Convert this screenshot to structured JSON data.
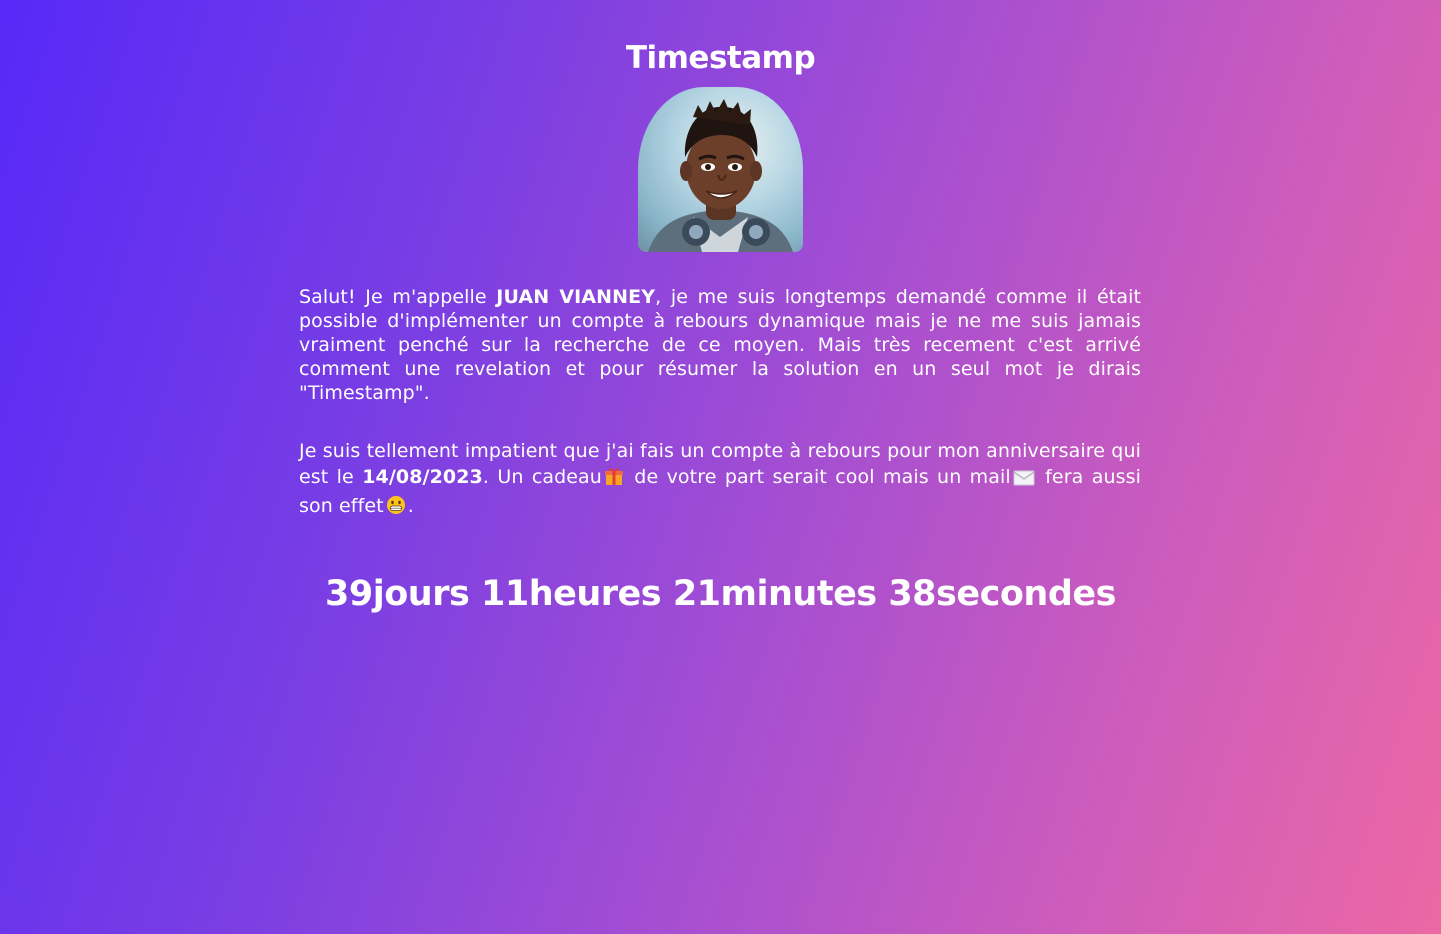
{
  "page": {
    "title": "Timestamp",
    "background_colors": [
      "#5729f8",
      "#ec68a4"
    ]
  },
  "intro": {
    "greeting": "Salut! Je m'appelle ",
    "name": "JUAN VIANNEY",
    "body": ", je me suis longtemps demandé comme il était possible d'implémenter un compte à rebours dynamique mais je ne me suis jamais vraiment penché sur la recherche de ce moyen. Mais très recement c'est arrivé comment une revelation et pour résumer la solution en un seul mot je dirais \"Timestamp\"."
  },
  "birthday": {
    "text_before_date": "Je suis tellement impatient que j'ai fais un compte à rebours pour mon anniversaire qui est le ",
    "date": "14/08/2023",
    "text_after_date": ". Un cadeau",
    "text_after_gift": " de votre part serait cool mais un mail",
    "text_after_mail": " fera aussi son effet",
    "text_end": ".",
    "icons": [
      "gift-icon",
      "envelope-icon",
      "grinning-face-icon"
    ]
  },
  "countdown": {
    "days": "39",
    "days_unit": "jours",
    "hours": "11",
    "hours_unit": "heures",
    "minutes": "21",
    "minutes_unit": "minutes",
    "seconds": "38",
    "seconds_unit": "secondes"
  }
}
